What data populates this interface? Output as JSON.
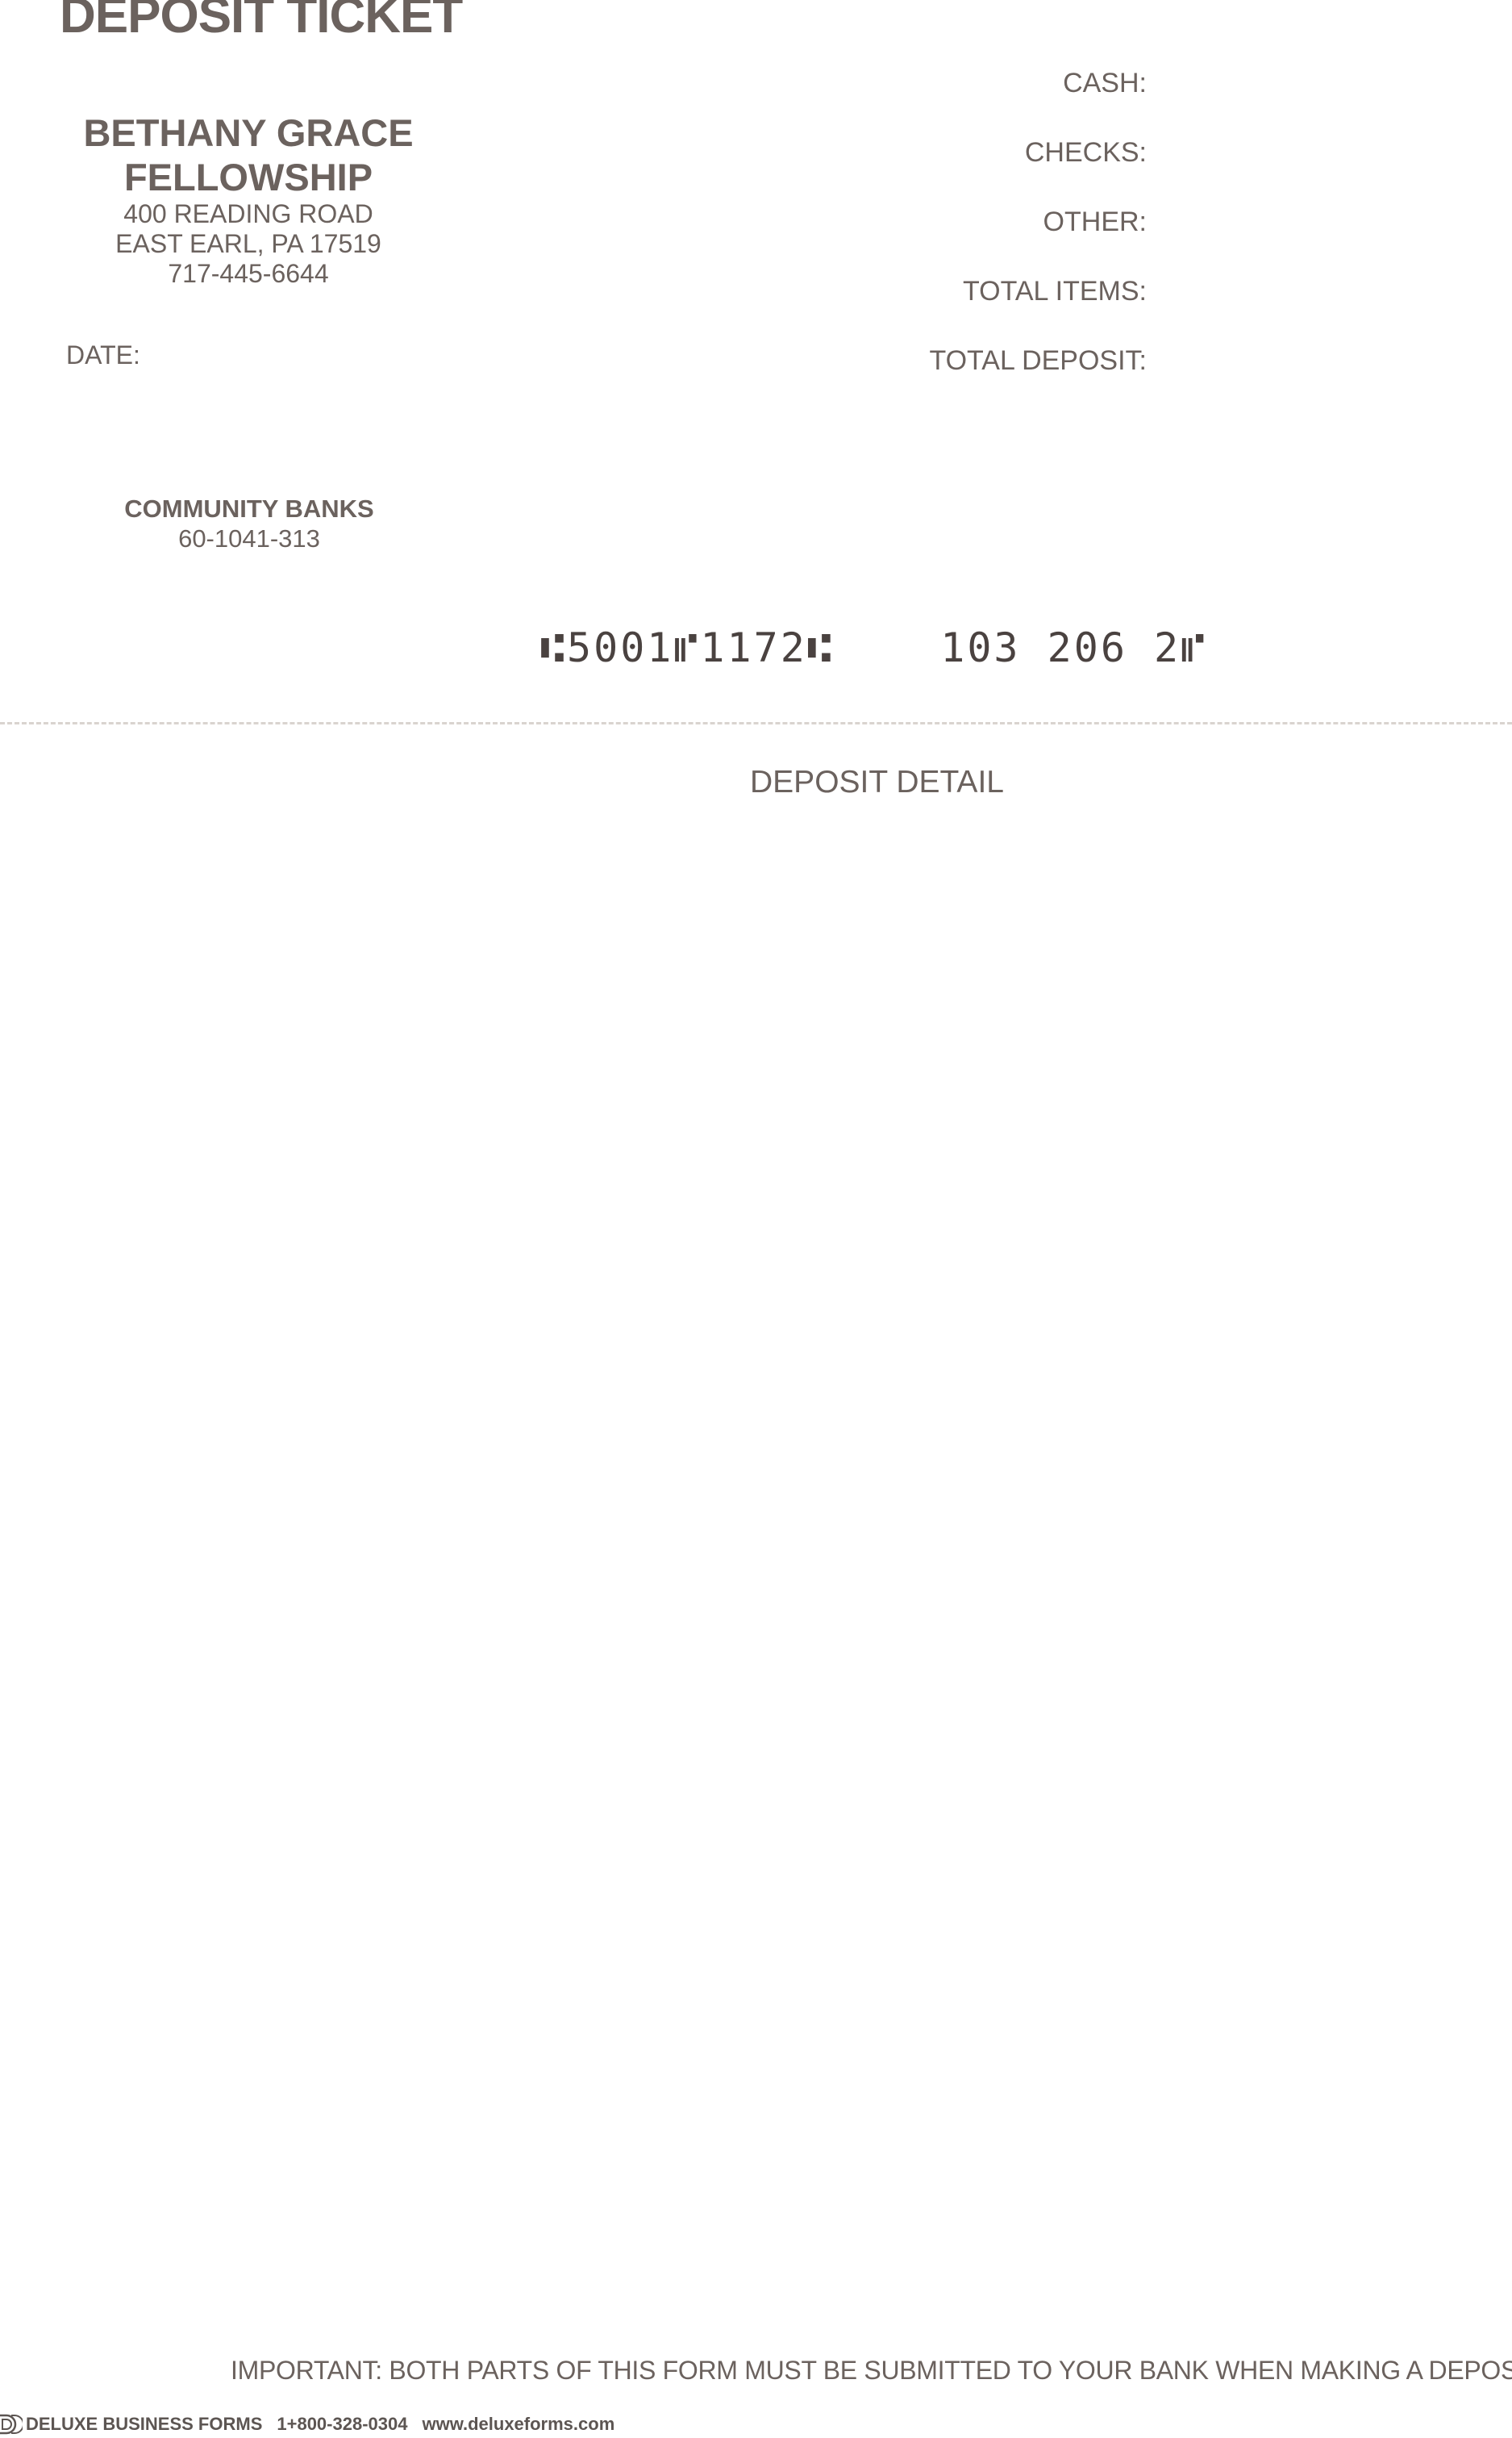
{
  "ticket": {
    "title": "DEPOSIT TICKET"
  },
  "organization": {
    "name_line1": "BETHANY GRACE",
    "name_line2": "FELLOWSHIP",
    "address_line1": "400 READING ROAD",
    "address_line2": "EAST EARL, PA 17519",
    "phone": "717-445-6644"
  },
  "date_label": "DATE:",
  "summary": {
    "cash_label": "CASH:",
    "checks_label": "CHECKS:",
    "other_label": "OTHER:",
    "total_items_label": "TOTAL ITEMS:",
    "total_deposit_label": "TOTAL DEPOSIT:"
  },
  "bank": {
    "name": "COMMUNITY BANKS",
    "routing_fraction": "60-1041-313"
  },
  "micr": {
    "line": "⑆5001⑈1172⑆    103 206 2⑈"
  },
  "detail": {
    "heading": "DEPOSIT DETAIL"
  },
  "important_note": "IMPORTANT: BOTH PARTS OF THIS FORM MUST BE SUBMITTED TO YOUR BANK WHEN MAKING A DEPOSIT",
  "footer": {
    "logo_icon": "deluxe-logo-icon",
    "company": "DELUXE BUSINESS FORMS",
    "phone": "1+800-328-0304",
    "website": "www.deluxeforms.com"
  }
}
